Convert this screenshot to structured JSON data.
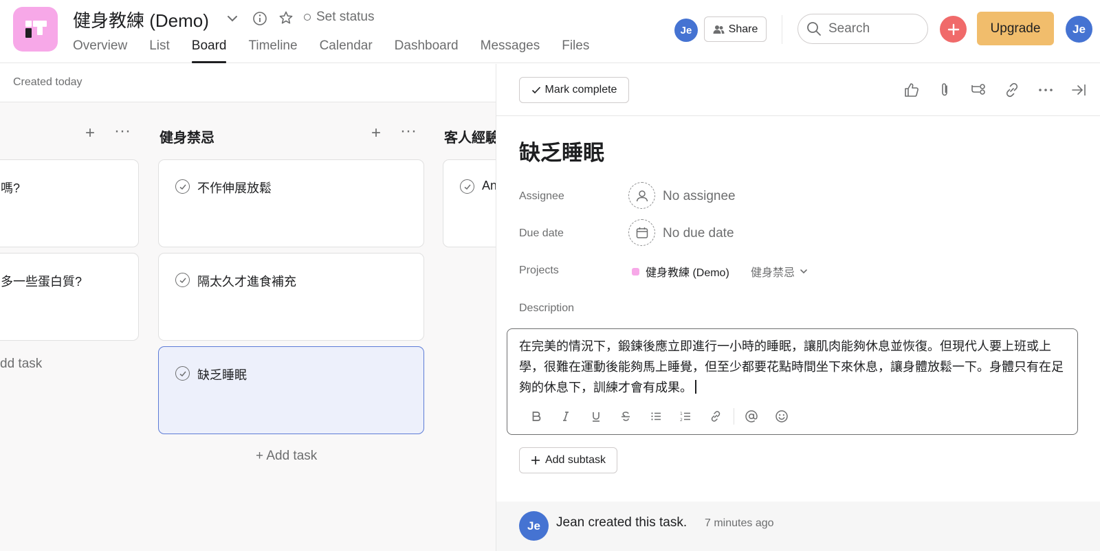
{
  "header": {
    "project_title": "健身教練 (Demo)",
    "set_status": "Set status",
    "tabs": [
      {
        "label": "Overview"
      },
      {
        "label": "List"
      },
      {
        "label": "Board"
      },
      {
        "label": "Timeline"
      },
      {
        "label": "Calendar"
      },
      {
        "label": "Dashboard"
      },
      {
        "label": "Messages"
      },
      {
        "label": "Files"
      }
    ],
    "active_tab": "Board",
    "member_avatar": "Je",
    "share_label": "Share",
    "search_placeholder": "Search",
    "upgrade_label": "Upgrade",
    "user_avatar": "Je",
    "accent_color": "#f06a6a",
    "upgrade_color": "#f1bd6c",
    "avatar_color": "#4573d2"
  },
  "board": {
    "created_text": "Created today",
    "columns": [
      {
        "name": "",
        "cards": [
          {
            "title": "嗎?"
          },
          {
            "title": "多一些蛋白質?"
          }
        ],
        "add_task": "dd task"
      },
      {
        "name": "健身禁忌",
        "cards": [
          {
            "title": "不作伸展放鬆"
          },
          {
            "title": "隔太久才進食補充"
          },
          {
            "title": "缺乏睡眠"
          }
        ],
        "add_task": "+ Add task"
      },
      {
        "name": "客人經驗",
        "cards": [
          {
            "title": "An"
          }
        ]
      }
    ]
  },
  "task_pane": {
    "mark_complete": "Mark complete",
    "title": "缺乏睡眠",
    "assignee_label": "Assignee",
    "assignee_value": "No assignee",
    "due_label": "Due date",
    "due_value": "No due date",
    "projects_label": "Projects",
    "project_name": "健身教練 (Demo)",
    "section_name": "健身禁忌",
    "description_label": "Description",
    "description": "在完美的情況下，鍛鍊後應立即進行一小時的睡眠，讓肌肉能夠休息並恢復。但現代人要上班或上學，很難在運動後能夠馬上睡覺，但至少都要花點時間坐下來休息，讓身體放鬆一下。身體只有在足夠的休息下，訓練才會有成果。",
    "add_subtask": "Add subtask",
    "activity_avatar": "Je",
    "activity_text": "Jean created this task.",
    "activity_time": "7 minutes ago"
  }
}
